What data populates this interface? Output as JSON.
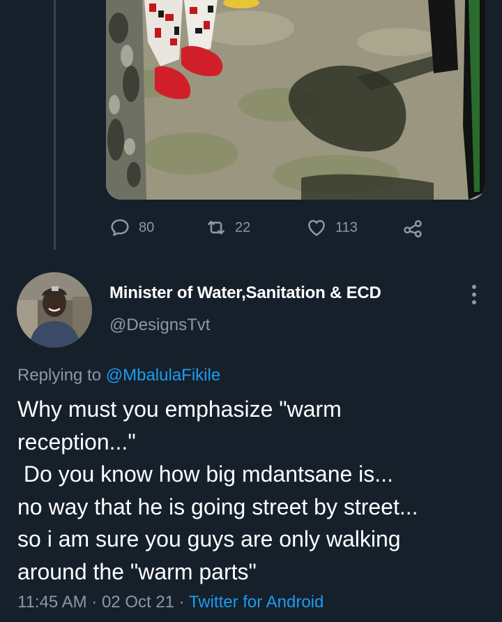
{
  "actions": {
    "reply_count": "80",
    "retweet_count": "22",
    "like_count": "113"
  },
  "tweet": {
    "display_name": "Minister of Water,Sanitation & ECD",
    "handle": "@DesignsTvt",
    "replying_prefix": "Replying to ",
    "replying_mention": "@MbalulaFikile",
    "body": "Why must you emphasize \"warm\nreception...\"\n Do you know how big mdantsane is...\nno way that he is going street by street...\nso i am sure you guys are only walking\naround the \"warm parts\"",
    "time": "11:45 AM",
    "date": "02 Oct 21",
    "source": "Twitter for Android"
  },
  "icons": {
    "reply": "reply-icon",
    "retweet": "retweet-icon",
    "like": "heart-icon",
    "share": "share-icon",
    "more": "more-options-icon"
  },
  "colors": {
    "background": "#15202b",
    "text_primary": "#ffffff",
    "text_secondary": "#8b98a5",
    "accent": "#1d9bf0"
  }
}
